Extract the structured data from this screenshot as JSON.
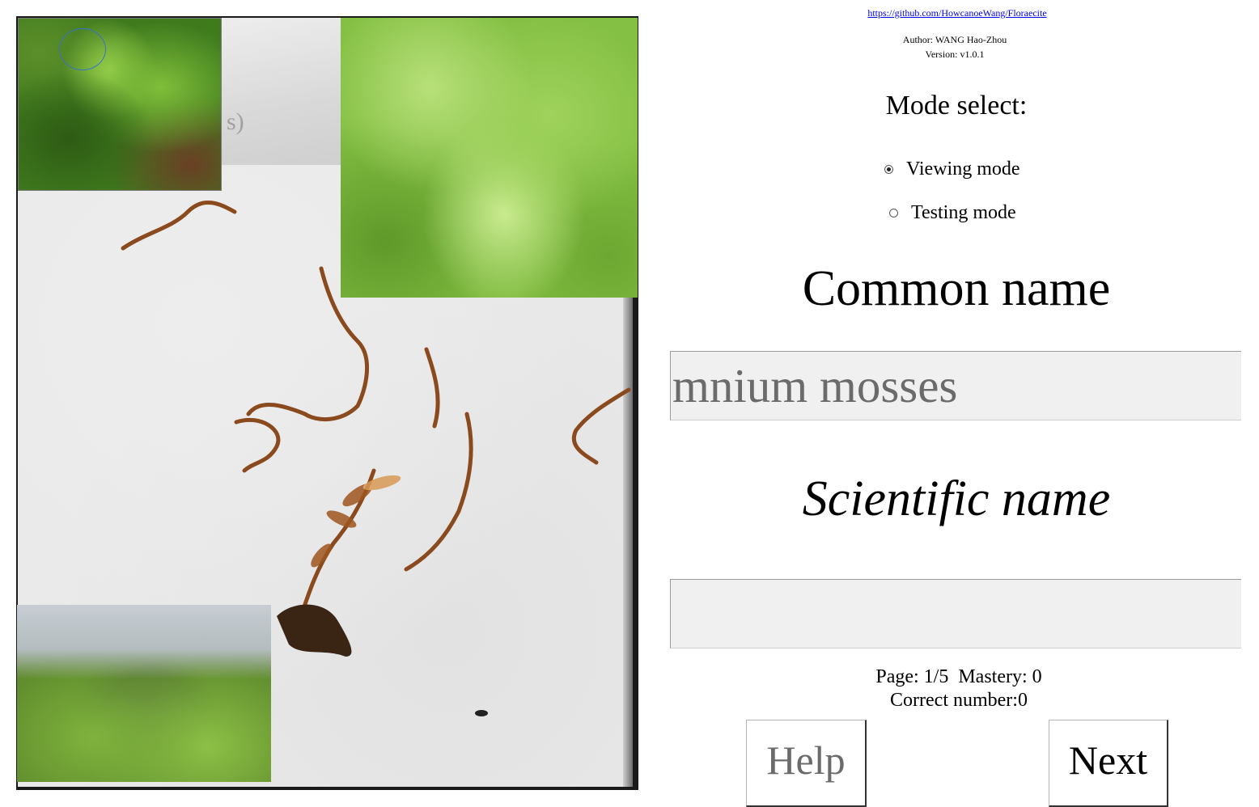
{
  "repo_link": "https://github.com/HowcanoeWang/Floraecite",
  "author": "Author: WANG Hao-Zhou",
  "version": "Version: v1.0.1",
  "mode": {
    "title": "Mode select:",
    "options": [
      {
        "label": "Viewing mode",
        "selected": true
      },
      {
        "label": "Testing mode",
        "selected": false
      }
    ]
  },
  "common_name": {
    "title": "Common name",
    "value": "mnium mosses"
  },
  "scientific_name": {
    "title": "Scientific name",
    "value": ""
  },
  "status": {
    "line1": "Page: 1/5  Mastery: 0",
    "line2": "Correct number:0"
  },
  "buttons": {
    "help": "Help",
    "next": "Next"
  },
  "specimen": {
    "ghost_text": "s)"
  }
}
